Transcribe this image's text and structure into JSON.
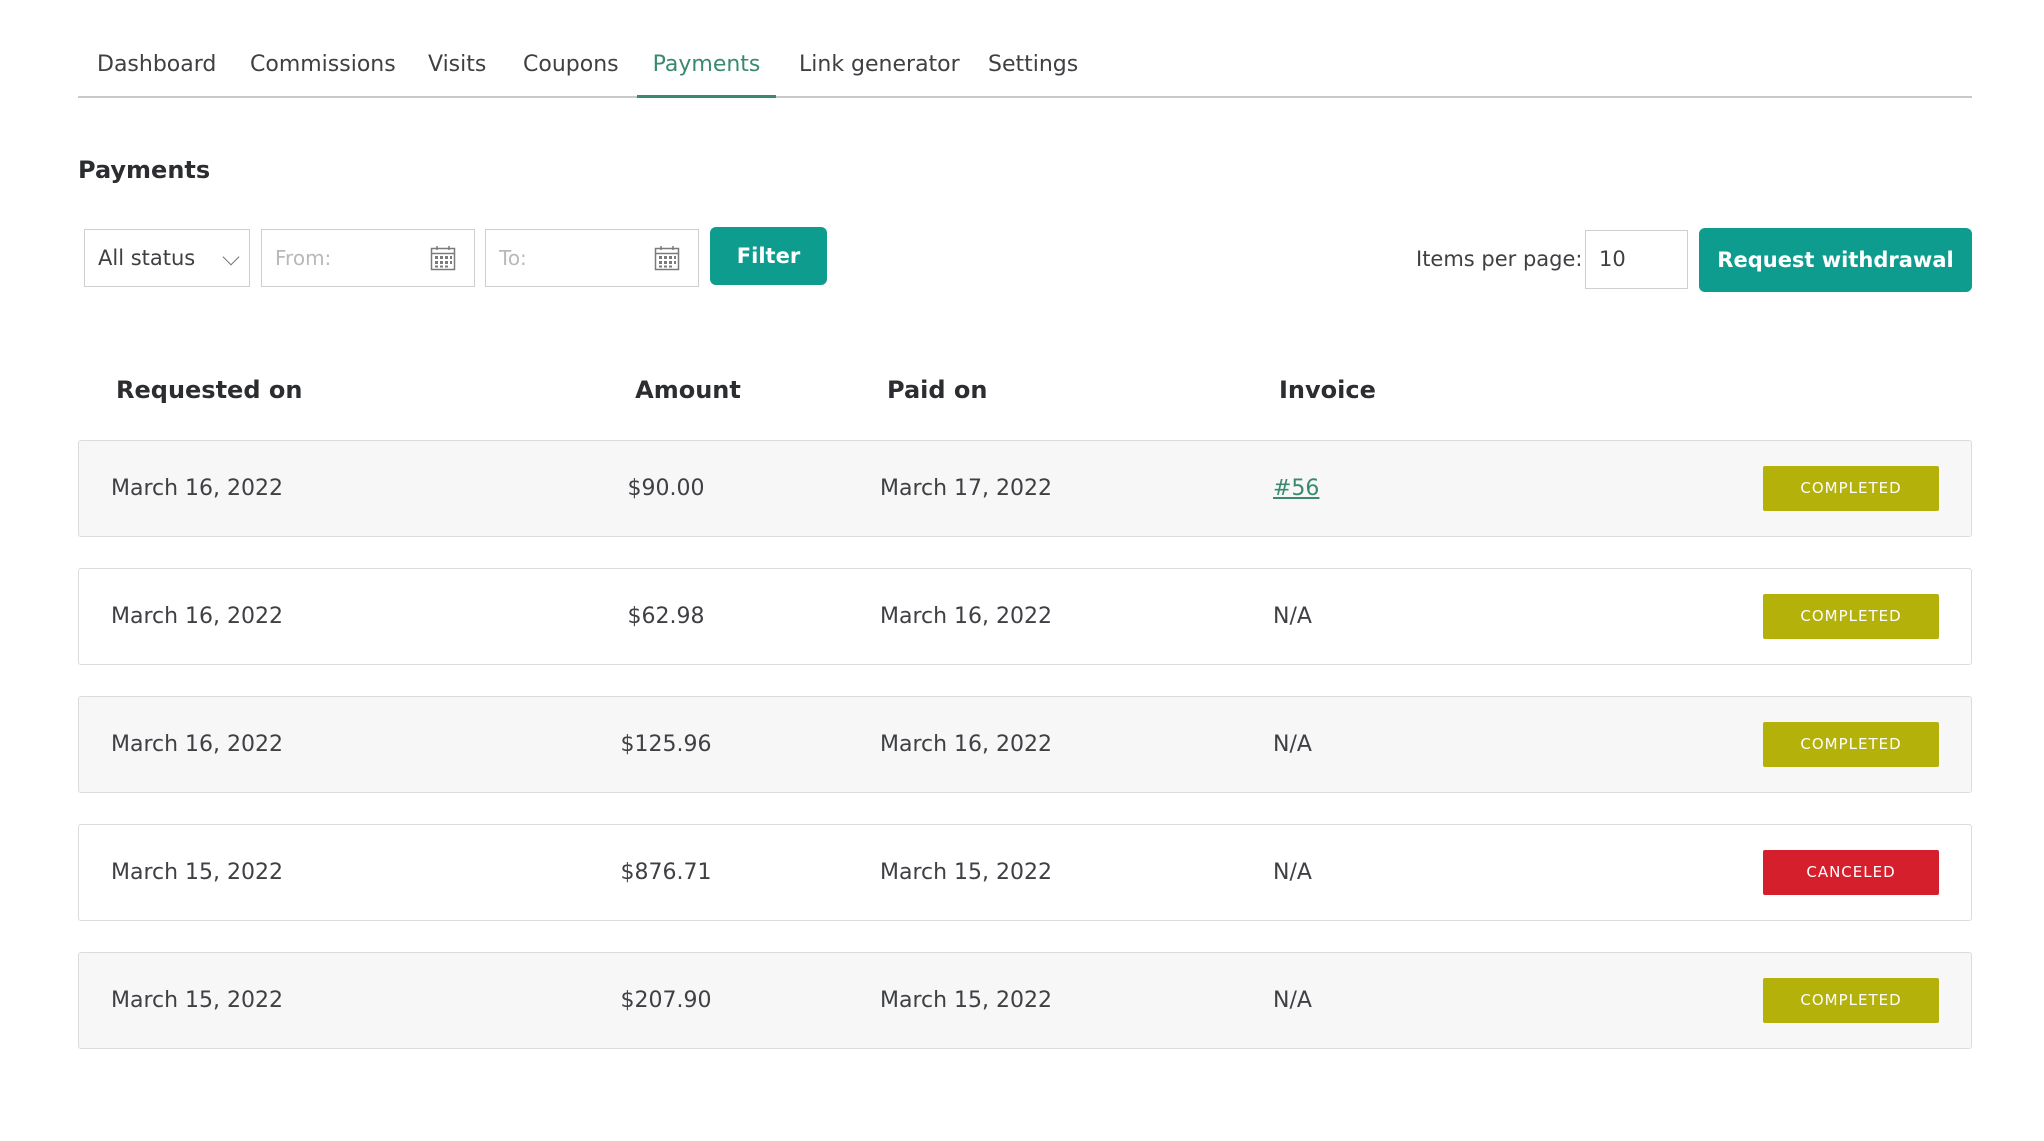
{
  "tabs": [
    {
      "label": "Dashboard",
      "active": false
    },
    {
      "label": "Commissions",
      "active": false
    },
    {
      "label": "Visits",
      "active": false
    },
    {
      "label": "Coupons",
      "active": false
    },
    {
      "label": "Payments",
      "active": true
    },
    {
      "label": "Link generator",
      "active": false
    },
    {
      "label": "Settings",
      "active": false
    }
  ],
  "section_title": "Payments",
  "filters": {
    "status_value": "All status",
    "from_placeholder": "From:",
    "to_placeholder": "To:",
    "filter_label": "Filter"
  },
  "pagination": {
    "items_per_page_label": "Items per page:",
    "items_per_page_value": "10"
  },
  "withdraw_label": "Request withdrawal",
  "table": {
    "headers": {
      "requested_on": "Requested on",
      "amount": "Amount",
      "paid_on": "Paid on",
      "invoice": "Invoice"
    },
    "rows": [
      {
        "requested_on": "March 16, 2022",
        "amount": "$90.00",
        "paid_on": "March 17, 2022",
        "invoice": "#56",
        "invoice_link": true,
        "status": "COMPLETED"
      },
      {
        "requested_on": "March 16, 2022",
        "amount": "$62.98",
        "paid_on": "March 16, 2022",
        "invoice": "N/A",
        "invoice_link": false,
        "status": "COMPLETED"
      },
      {
        "requested_on": "March 16, 2022",
        "amount": "$125.96",
        "paid_on": "March 16, 2022",
        "invoice": "N/A",
        "invoice_link": false,
        "status": "COMPLETED"
      },
      {
        "requested_on": "March 15, 2022",
        "amount": "$876.71",
        "paid_on": "March 15, 2022",
        "invoice": "N/A",
        "invoice_link": false,
        "status": "CANCELED"
      },
      {
        "requested_on": "March 15, 2022",
        "amount": "$207.90",
        "paid_on": "March 15, 2022",
        "invoice": "N/A",
        "invoice_link": false,
        "status": "COMPLETED"
      }
    ]
  },
  "colors": {
    "accent": "#0e9c8f",
    "active_tab": "#3a8a70",
    "status_completed": "#b3b10a",
    "status_canceled": "#d61f2c"
  },
  "icons": {
    "status_dropdown": "chevron-down-icon",
    "date_picker": "calendar-icon"
  }
}
